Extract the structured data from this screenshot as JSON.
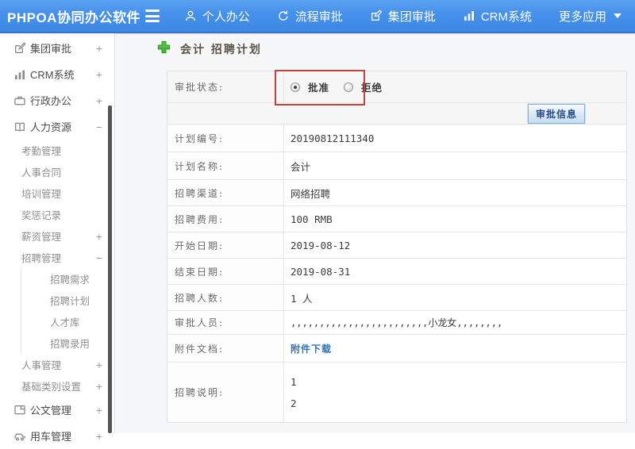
{
  "colors": {
    "topbar_blue": "#4490ea",
    "accent_green": "#46b435",
    "annotation_red": "#c0443c",
    "link_blue": "#2f74b5",
    "button_text_blue": "#274b85"
  },
  "topbar": {
    "logo": "PHPOA协同办公软件",
    "nav": [
      {
        "label": "个人办公",
        "icon": "person-icon"
      },
      {
        "label": "流程审批",
        "icon": "process-cycle-icon"
      },
      {
        "label": "集团审批",
        "icon": "edit-square-icon"
      },
      {
        "label": "CRM系统",
        "icon": "bar-chart-icon"
      },
      {
        "label": "更多应用",
        "icon": "caret-down-icon"
      }
    ]
  },
  "sidebar": {
    "expander_plus": "+",
    "expander_minus": "−",
    "items": [
      {
        "label": "集团审批",
        "icon": "edit-square-icon",
        "state": "collapsed"
      },
      {
        "label": "CRM系统",
        "icon": "bar-chart-icon",
        "state": "collapsed"
      },
      {
        "label": "行政办公",
        "icon": "briefcase-icon",
        "state": "collapsed"
      },
      {
        "label": "人力资源",
        "icon": "book-icon",
        "state": "expanded",
        "children": [
          {
            "label": "考勤管理"
          },
          {
            "label": "人事合同"
          },
          {
            "label": "培训管理"
          },
          {
            "label": "奖惩记录"
          },
          {
            "label": "薪资管理",
            "state": "collapsed"
          },
          {
            "label": "招聘管理",
            "state": "expanded",
            "children": [
              {
                "label": "招聘需求"
              },
              {
                "label": "招聘计划"
              },
              {
                "label": "人才库"
              },
              {
                "label": "招聘录用"
              }
            ]
          },
          {
            "label": "人事管理",
            "state": "collapsed"
          },
          {
            "label": "基础类别设置",
            "state": "collapsed"
          }
        ]
      },
      {
        "label": "公文管理",
        "icon": "document-icon",
        "state": "collapsed"
      },
      {
        "label": "用车管理",
        "icon": "car-icon",
        "state": "collapsed"
      }
    ]
  },
  "main": {
    "title": "会计 招聘计划",
    "title_icon": "plus-icon",
    "approval": {
      "label": "审批状态:",
      "options": [
        {
          "label": "批准",
          "selected": true
        },
        {
          "label": "拒绝",
          "selected": false
        }
      ]
    },
    "approve_button": "审批信息",
    "rows": [
      {
        "label": "计划编号:",
        "value": "20190812111340"
      },
      {
        "label": "计划名称:",
        "value": "会计"
      },
      {
        "label": "招聘渠道:",
        "value": "网络招聘"
      },
      {
        "label": "招聘费用:",
        "value": "100 RMB"
      },
      {
        "label": "开始日期:",
        "value": "2019-08-12"
      },
      {
        "label": "结束日期:",
        "value": "2019-08-31"
      },
      {
        "label": "招聘人数:",
        "value": "1 人"
      },
      {
        "label": "审批人员:",
        "value": ",,,,,,,,,,,,,,,,,,,,,,,,小龙女,,,,,,,,"
      },
      {
        "label": "附件文档:",
        "value": "附件下载"
      },
      {
        "label": "招聘说明:",
        "value_lines": [
          "1",
          "2"
        ]
      }
    ]
  }
}
